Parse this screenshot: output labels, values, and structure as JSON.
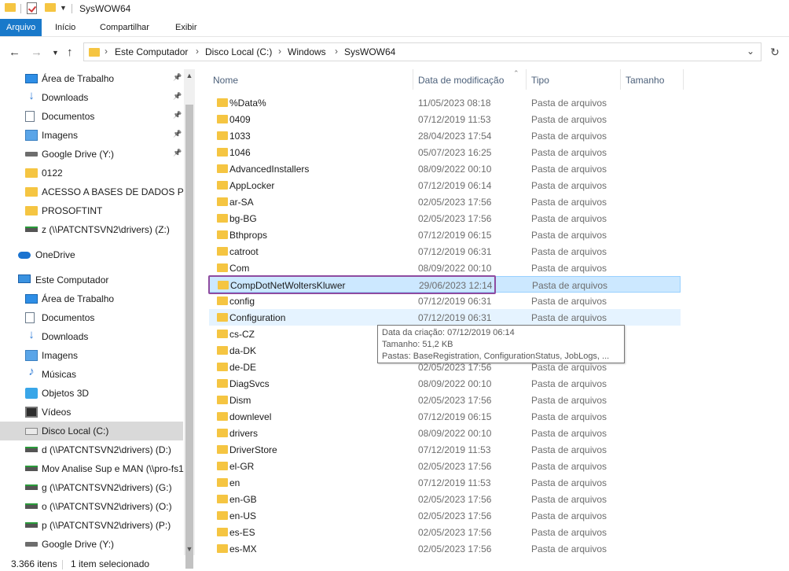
{
  "window": {
    "title": "SysWOW64"
  },
  "ribbon": {
    "tabs": [
      "Arquivo",
      "Início",
      "Compartilhar",
      "Exibir"
    ]
  },
  "address": {
    "crumbs": [
      "Este Computador",
      "Disco Local (C:)",
      "Windows",
      "SysWOW64"
    ]
  },
  "nav": {
    "items": [
      {
        "label": "Área de Trabalho",
        "icon": "desktop-icon",
        "pinned": true
      },
      {
        "label": "Downloads",
        "icon": "download-icon",
        "pinned": true
      },
      {
        "label": "Documentos",
        "icon": "document-icon",
        "pinned": true
      },
      {
        "label": "Imagens",
        "icon": "image-icon",
        "pinned": true
      },
      {
        "label": "Google Drive (Y:)",
        "icon": "drive-icon",
        "pinned": true
      },
      {
        "label": "0122",
        "icon": "folder-icon",
        "pinned": false
      },
      {
        "label": "ACESSO A BASES DE DADOS PCC I",
        "icon": "folder-icon",
        "pinned": false
      },
      {
        "label": "PROSOFTINT",
        "icon": "folder-icon",
        "pinned": false
      },
      {
        "label": "z (\\\\PATCNTSVN2\\drivers) (Z:)",
        "icon": "network-drive-icon",
        "pinned": false
      },
      {
        "label": "OneDrive",
        "icon": "onedrive-icon",
        "pinned": false
      },
      {
        "label": "Este Computador",
        "icon": "computer-icon",
        "pinned": false
      },
      {
        "label": "Área de Trabalho",
        "icon": "desktop-icon",
        "pinned": false
      },
      {
        "label": "Documentos",
        "icon": "document-icon",
        "pinned": false
      },
      {
        "label": "Downloads",
        "icon": "download-icon",
        "pinned": false
      },
      {
        "label": "Imagens",
        "icon": "image-icon",
        "pinned": false
      },
      {
        "label": "Músicas",
        "icon": "music-icon",
        "pinned": false
      },
      {
        "label": "Objetos 3D",
        "icon": "objects-3d-icon",
        "pinned": false
      },
      {
        "label": "Vídeos",
        "icon": "video-icon",
        "pinned": false
      },
      {
        "label": "Disco Local (C:)",
        "icon": "local-disk-icon",
        "pinned": false,
        "selected": true
      },
      {
        "label": "d (\\\\PATCNTSVN2\\drivers) (D:)",
        "icon": "network-drive-icon",
        "pinned": false
      },
      {
        "label": "Mov Analise Sup e MAN (\\\\pro-fs1",
        "icon": "network-drive-icon",
        "pinned": false
      },
      {
        "label": "g (\\\\PATCNTSVN2\\drivers) (G:)",
        "icon": "network-drive-icon",
        "pinned": false
      },
      {
        "label": "o (\\\\PATCNTSVN2\\drivers) (O:)",
        "icon": "network-drive-icon",
        "pinned": false
      },
      {
        "label": "p (\\\\PATCNTSVN2\\drivers) (P:)",
        "icon": "network-drive-icon",
        "pinned": false
      },
      {
        "label": "Google Drive (Y:)",
        "icon": "drive-icon",
        "pinned": false
      }
    ]
  },
  "columns": {
    "name": "Nome",
    "date": "Data de modificação",
    "type": "Tipo",
    "size": "Tamanho"
  },
  "files": [
    {
      "name": "%Data%",
      "date": "11/05/2023 08:18",
      "type": "Pasta de arquivos"
    },
    {
      "name": "0409",
      "date": "07/12/2019 11:53",
      "type": "Pasta de arquivos"
    },
    {
      "name": "1033",
      "date": "28/04/2023 17:54",
      "type": "Pasta de arquivos"
    },
    {
      "name": "1046",
      "date": "05/07/2023 16:25",
      "type": "Pasta de arquivos"
    },
    {
      "name": "AdvancedInstallers",
      "date": "08/09/2022 00:10",
      "type": "Pasta de arquivos"
    },
    {
      "name": "AppLocker",
      "date": "07/12/2019 06:14",
      "type": "Pasta de arquivos"
    },
    {
      "name": "ar-SA",
      "date": "02/05/2023 17:56",
      "type": "Pasta de arquivos"
    },
    {
      "name": "bg-BG",
      "date": "02/05/2023 17:56",
      "type": "Pasta de arquivos"
    },
    {
      "name": "Bthprops",
      "date": "07/12/2019 06:15",
      "type": "Pasta de arquivos"
    },
    {
      "name": "catroot",
      "date": "07/12/2019 06:31",
      "type": "Pasta de arquivos"
    },
    {
      "name": "Com",
      "date": "08/09/2022 00:10",
      "type": "Pasta de arquivos"
    },
    {
      "name": "CompDotNetWoltersKluwer",
      "date": "29/06/2023 12:14",
      "type": "Pasta de arquivos",
      "state": "selected"
    },
    {
      "name": "config",
      "date": "07/12/2019 06:31",
      "type": "Pasta de arquivos"
    },
    {
      "name": "Configuration",
      "date": "07/12/2019 06:31",
      "type": "Pasta de arquivos",
      "state": "hover"
    },
    {
      "name": "cs-CZ",
      "date": "",
      "type": ""
    },
    {
      "name": "da-DK",
      "date": "",
      "type": ""
    },
    {
      "name": "de-DE",
      "date": "02/05/2023 17:56",
      "type": "Pasta de arquivos"
    },
    {
      "name": "DiagSvcs",
      "date": "08/09/2022 00:10",
      "type": "Pasta de arquivos"
    },
    {
      "name": "Dism",
      "date": "02/05/2023 17:56",
      "type": "Pasta de arquivos"
    },
    {
      "name": "downlevel",
      "date": "07/12/2019 06:15",
      "type": "Pasta de arquivos"
    },
    {
      "name": "drivers",
      "date": "08/09/2022 00:10",
      "type": "Pasta de arquivos"
    },
    {
      "name": "DriverStore",
      "date": "07/12/2019 11:53",
      "type": "Pasta de arquivos"
    },
    {
      "name": "el-GR",
      "date": "02/05/2023 17:56",
      "type": "Pasta de arquivos"
    },
    {
      "name": "en",
      "date": "07/12/2019 11:53",
      "type": "Pasta de arquivos"
    },
    {
      "name": "en-GB",
      "date": "02/05/2023 17:56",
      "type": "Pasta de arquivos"
    },
    {
      "name": "en-US",
      "date": "02/05/2023 17:56",
      "type": "Pasta de arquivos"
    },
    {
      "name": "es-ES",
      "date": "02/05/2023 17:56",
      "type": "Pasta de arquivos"
    },
    {
      "name": "es-MX",
      "date": "02/05/2023 17:56",
      "type": "Pasta de arquivos"
    }
  ],
  "tooltip": {
    "line1": "Data da criação: 07/12/2019 06:14",
    "line2": "Tamanho: 51,2 KB",
    "line3": "Pastas: BaseRegistration, ConfigurationStatus, JobLogs, ..."
  },
  "status": {
    "count": "3.366 itens",
    "selection": "1 item selecionado"
  },
  "colors": {
    "accent": "#1979ca",
    "selection": "#cce8ff",
    "folder": "#f5c542",
    "focus_outline": "#8e4ba0"
  }
}
